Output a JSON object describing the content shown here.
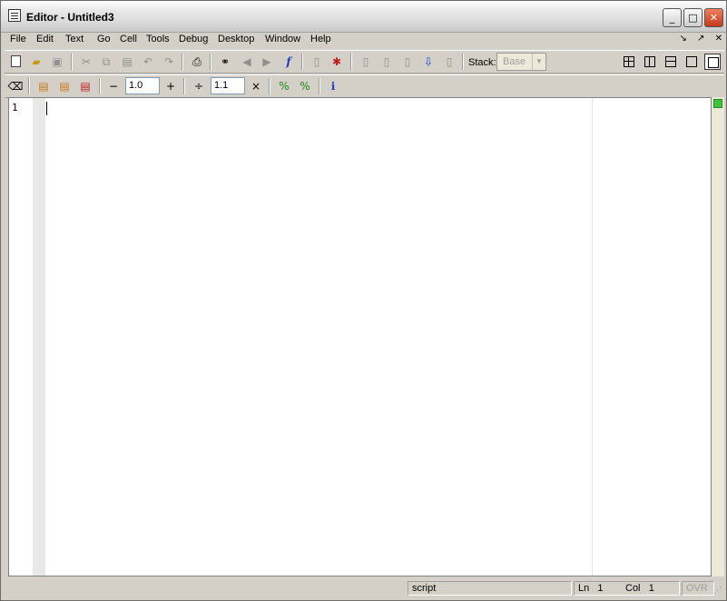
{
  "window": {
    "title": "Editor - Untitled3",
    "controls": {
      "minimize": "_",
      "maximize": "□",
      "close": "✕"
    }
  },
  "menu": {
    "items": [
      "File",
      "Edit",
      "Text",
      "Go",
      "Cell",
      "Tools",
      "Debug",
      "Desktop",
      "Window",
      "Help"
    ],
    "dock_undock": "↘",
    "dock_pin": "↗",
    "dock_close": "✕"
  },
  "toolbar": {
    "new_icon": "new-file-icon",
    "open_icon": "open-folder-icon",
    "save_icon": "save-icon",
    "cut_icon": "cut-icon",
    "copy_icon": "copy-icon",
    "paste_icon": "paste-icon",
    "undo_icon": "undo-icon",
    "redo_icon": "redo-icon",
    "print_icon": "print-icon",
    "find_icon": "binoculars-icon",
    "back_icon": "back-arrow-icon",
    "forward_icon": "forward-arrow-icon",
    "function_glyph": "f",
    "stack_label": "Stack:",
    "stack_value": "Base"
  },
  "cell_toolbar": {
    "decrement_label": "−",
    "increment_value": "1.0",
    "increment_label": "+",
    "divide_label": "÷",
    "divide_value": "1.1",
    "multiply_label": "×"
  },
  "editor": {
    "line_numbers": [
      "1"
    ],
    "content": ""
  },
  "statusbar": {
    "mode": "script",
    "ln_label": "Ln",
    "ln_value": "1",
    "col_label": "Col",
    "col_value": "1",
    "ovr": "OVR"
  },
  "colors": {
    "chrome": "#d4d0c8",
    "editor_bg": "#ffffff",
    "fold_column": "#e8e8e8",
    "status_ok": "#3ec43e",
    "close_button": "#c23a1a"
  }
}
